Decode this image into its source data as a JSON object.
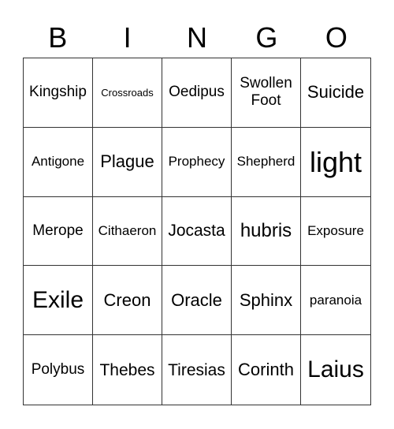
{
  "header": [
    "B",
    "I",
    "N",
    "G",
    "O"
  ],
  "cells": [
    [
      "Kingship",
      "Crossroads",
      "Oedipus",
      "Swollen Foot",
      "Suicide"
    ],
    [
      "Antigone",
      "Plague",
      "Prophecy",
      "Shepherd",
      "light"
    ],
    [
      "Merope",
      "Cithaeron",
      "Jocasta",
      "hubris",
      "Exposure"
    ],
    [
      "Exile",
      "Creon",
      "Oracle",
      "Sphinx",
      "paranoia"
    ],
    [
      "Polybus",
      "Thebes",
      "Tiresias",
      "Corinth",
      "Laius"
    ]
  ]
}
